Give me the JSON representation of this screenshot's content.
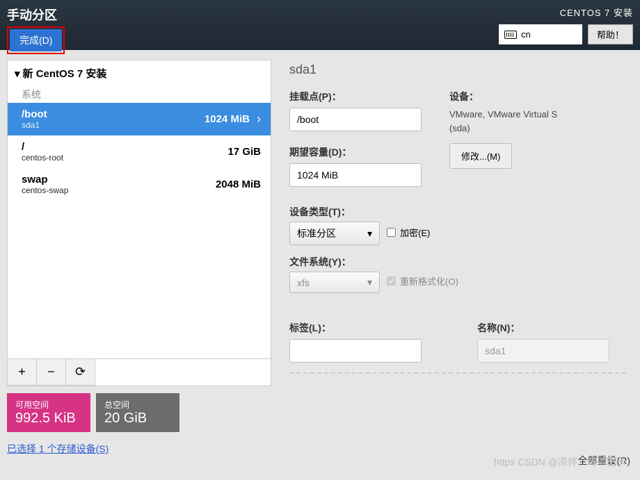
{
  "header": {
    "title": "手动分区",
    "done_button": "完成(D)",
    "installer_title": "CENTOS 7 安装",
    "keyboard_layout": "cn",
    "help_button": "帮助！"
  },
  "left": {
    "tree_header": "新 CentOS 7 安装",
    "section_label": "系统",
    "partitions": [
      {
        "name": "/boot",
        "sub": "sda1",
        "size": "1024 MiB",
        "selected": true
      },
      {
        "name": "/",
        "sub": "centos-root",
        "size": "17 GiB",
        "selected": false
      },
      {
        "name": "swap",
        "sub": "centos-swap",
        "size": "2048 MiB",
        "selected": false
      }
    ],
    "toolbar": {
      "add": "+",
      "remove": "−",
      "reload": "⟳"
    }
  },
  "right": {
    "device_title": "sda1",
    "mount_label": "挂载点(P)：",
    "mount_value": "/boot",
    "capacity_label": "期望容量(D)：",
    "capacity_value": "1024 MiB",
    "device_label": "设备：",
    "device_text": "VMware, VMware Virtual S (sda)",
    "modify_button": "修改...(M)",
    "device_type_label": "设备类型(T)：",
    "device_type_value": "标准分区",
    "encrypt_label": "加密(E)",
    "fs_label": "文件系统(Y)：",
    "fs_value": "xfs",
    "reformat_label": "重新格式化(O)",
    "tag_label": "标签(L)：",
    "tag_value": "",
    "name_label": "名称(N)：",
    "name_value": "sda1"
  },
  "bottom": {
    "avail_label": "可用空间",
    "avail_value": "992.5 KiB",
    "total_label": "总空间",
    "total_value": "20 GiB",
    "storage_link": "已选择 1 个存储设备(S)",
    "reset_link": "全部重设(R)"
  },
  "watermark": "https CSDN @凉拌…玛卡巴卡"
}
